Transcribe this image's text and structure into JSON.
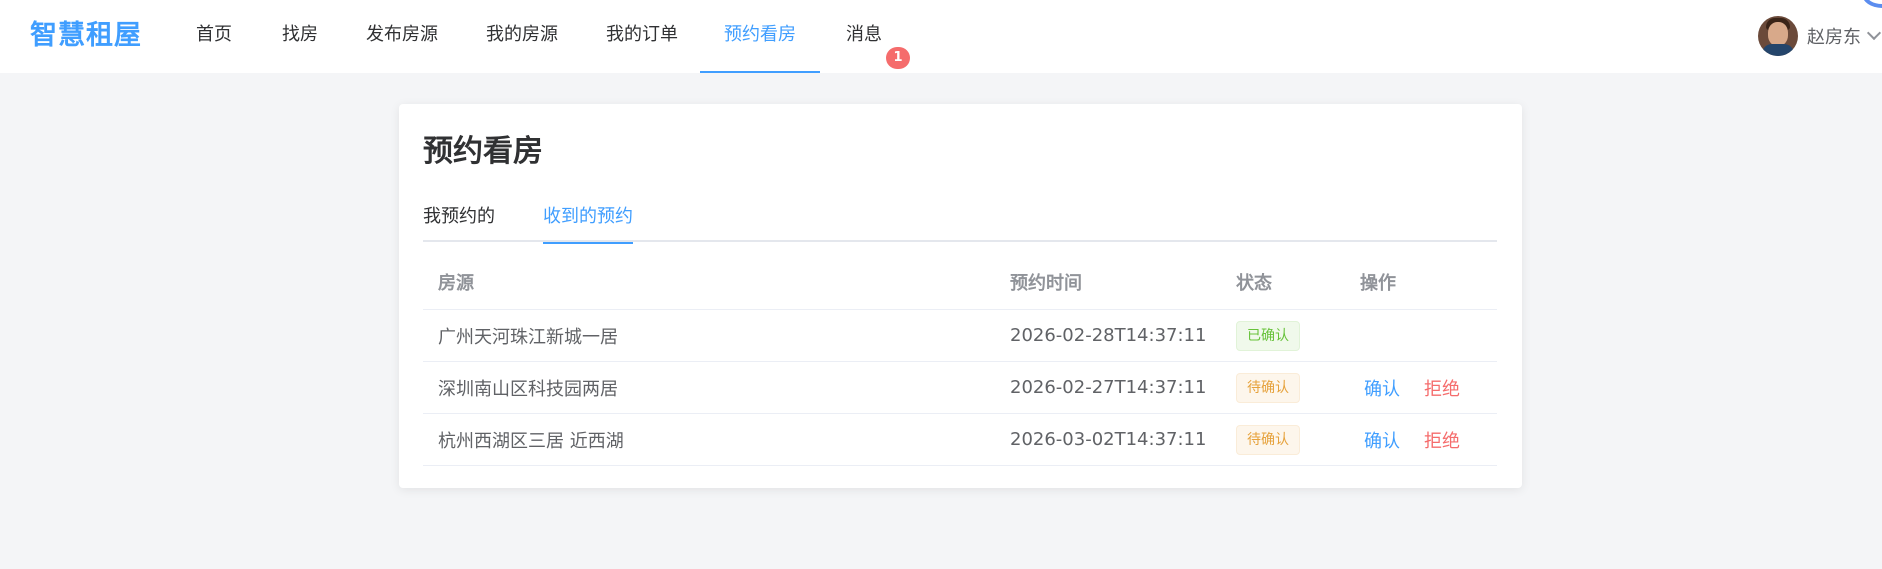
{
  "header": {
    "logo": "智慧租屋",
    "nav": [
      {
        "label": "首页",
        "active": false
      },
      {
        "label": "找房",
        "active": false
      },
      {
        "label": "发布房源",
        "active": false
      },
      {
        "label": "我的房源",
        "active": false
      },
      {
        "label": "我的订单",
        "active": false
      },
      {
        "label": "预约看房",
        "active": true
      },
      {
        "label": "消息",
        "active": false
      }
    ],
    "message_badge": "1",
    "user": {
      "name": "赵房东",
      "avatar_icon": "user-avatar-photo",
      "dropdown_icon": "chevron-down-icon"
    }
  },
  "card": {
    "title": "预约看房",
    "tabs": [
      {
        "label": "我预约的",
        "active": false
      },
      {
        "label": "收到的预约",
        "active": true
      }
    ],
    "table": {
      "columns": [
        "房源",
        "预约时间",
        "状态",
        "操作"
      ],
      "rows": [
        {
          "house": "广州天河珠江新城一居",
          "time": "2026-02-28T14:37:11",
          "status": "已确认",
          "status_type": "ok",
          "actions": []
        },
        {
          "house": "深圳南山区科技园两居",
          "time": "2026-02-27T14:37:11",
          "status": "待确认",
          "status_type": "pending",
          "actions": [
            "确认",
            "拒绝"
          ]
        },
        {
          "house": "杭州西湖区三居 近西湖",
          "time": "2026-03-02T14:37:11",
          "status": "待确认",
          "status_type": "pending",
          "actions": [
            "确认",
            "拒绝"
          ]
        }
      ]
    }
  },
  "colors": {
    "primary": "#409eff",
    "danger": "#f56c6c",
    "success": "#67c23a",
    "warning": "#e6a23c",
    "background": "#f4f5f7"
  }
}
